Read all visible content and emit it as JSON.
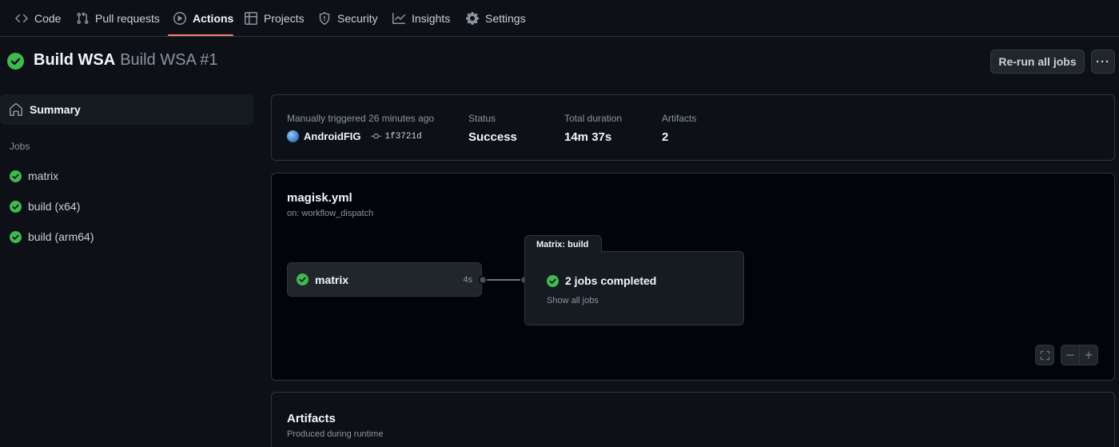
{
  "nav": {
    "tabs": [
      {
        "label": "Code",
        "icon": "code-icon"
      },
      {
        "label": "Pull requests",
        "icon": "git-pull-request-icon"
      },
      {
        "label": "Actions",
        "icon": "play-icon",
        "active": true
      },
      {
        "label": "Projects",
        "icon": "table-icon"
      },
      {
        "label": "Security",
        "icon": "shield-icon"
      },
      {
        "label": "Insights",
        "icon": "graph-icon"
      },
      {
        "label": "Settings",
        "icon": "gear-icon"
      }
    ]
  },
  "header": {
    "workflow_name": "Build WSA",
    "run_name": "Build WSA #1",
    "status_icon": "check-circle-fill-icon",
    "rerun_label": "Re-run all jobs",
    "more_label": "···"
  },
  "sidebar": {
    "summary_label": "Summary",
    "summary_icon": "home-icon",
    "jobs_heading": "Jobs",
    "jobs": [
      {
        "label": "matrix",
        "status": "success"
      },
      {
        "label": "build (x64)",
        "status": "success"
      },
      {
        "label": "build (arm64)",
        "status": "success"
      }
    ]
  },
  "summary": {
    "trigger_text": "Manually triggered 26 minutes ago",
    "actor": "AndroidFIG",
    "commit": "1f3721d",
    "status_label": "Status",
    "status_value": "Success",
    "duration_label": "Total duration",
    "duration_value": "14m 37s",
    "artifacts_label": "Artifacts",
    "artifacts_value": "2"
  },
  "graph": {
    "file": "magisk.yml",
    "trigger": "on: workflow_dispatch",
    "job_node": {
      "name": "matrix",
      "duration": "4s"
    },
    "matrix": {
      "title": "Matrix: build",
      "status": "2 jobs completed",
      "link": "Show all jobs"
    },
    "controls": {
      "fullscreen_icon": "screen-full-icon",
      "zoom_out": "−",
      "zoom_in": "+"
    }
  },
  "artifacts": {
    "title": "Artifacts",
    "subtitle": "Produced during runtime"
  },
  "colors": {
    "background": "#0d1117",
    "success": "#3fb950",
    "active_underline": "#f78166",
    "border": "#30363d"
  }
}
